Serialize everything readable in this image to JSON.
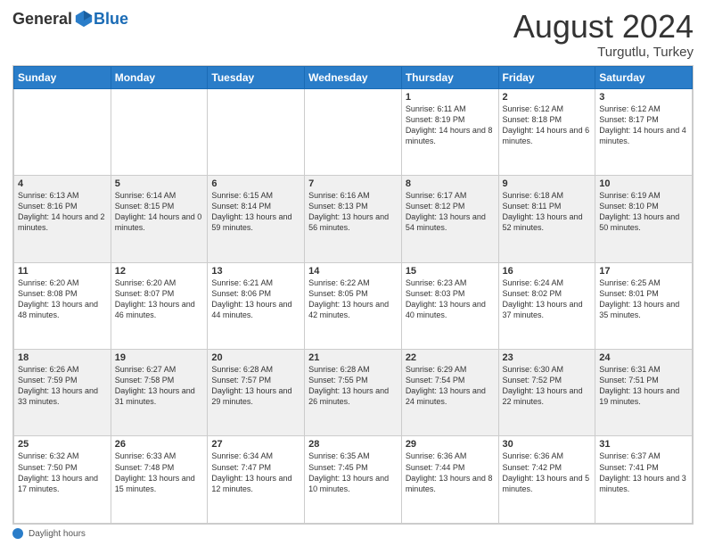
{
  "header": {
    "logo": {
      "general": "General",
      "blue": "Blue"
    },
    "title": "August 2024",
    "location": "Turgutlu, Turkey"
  },
  "calendar": {
    "days_of_week": [
      "Sunday",
      "Monday",
      "Tuesday",
      "Wednesday",
      "Thursday",
      "Friday",
      "Saturday"
    ],
    "weeks": [
      [
        {
          "day": "",
          "info": ""
        },
        {
          "day": "",
          "info": ""
        },
        {
          "day": "",
          "info": ""
        },
        {
          "day": "",
          "info": ""
        },
        {
          "day": "1",
          "info": "Sunrise: 6:11 AM\nSunset: 8:19 PM\nDaylight: 14 hours and 8 minutes."
        },
        {
          "day": "2",
          "info": "Sunrise: 6:12 AM\nSunset: 8:18 PM\nDaylight: 14 hours and 6 minutes."
        },
        {
          "day": "3",
          "info": "Sunrise: 6:12 AM\nSunset: 8:17 PM\nDaylight: 14 hours and 4 minutes."
        }
      ],
      [
        {
          "day": "4",
          "info": "Sunrise: 6:13 AM\nSunset: 8:16 PM\nDaylight: 14 hours and 2 minutes."
        },
        {
          "day": "5",
          "info": "Sunrise: 6:14 AM\nSunset: 8:15 PM\nDaylight: 14 hours and 0 minutes."
        },
        {
          "day": "6",
          "info": "Sunrise: 6:15 AM\nSunset: 8:14 PM\nDaylight: 13 hours and 59 minutes."
        },
        {
          "day": "7",
          "info": "Sunrise: 6:16 AM\nSunset: 8:13 PM\nDaylight: 13 hours and 56 minutes."
        },
        {
          "day": "8",
          "info": "Sunrise: 6:17 AM\nSunset: 8:12 PM\nDaylight: 13 hours and 54 minutes."
        },
        {
          "day": "9",
          "info": "Sunrise: 6:18 AM\nSunset: 8:11 PM\nDaylight: 13 hours and 52 minutes."
        },
        {
          "day": "10",
          "info": "Sunrise: 6:19 AM\nSunset: 8:10 PM\nDaylight: 13 hours and 50 minutes."
        }
      ],
      [
        {
          "day": "11",
          "info": "Sunrise: 6:20 AM\nSunset: 8:08 PM\nDaylight: 13 hours and 48 minutes."
        },
        {
          "day": "12",
          "info": "Sunrise: 6:20 AM\nSunset: 8:07 PM\nDaylight: 13 hours and 46 minutes."
        },
        {
          "day": "13",
          "info": "Sunrise: 6:21 AM\nSunset: 8:06 PM\nDaylight: 13 hours and 44 minutes."
        },
        {
          "day": "14",
          "info": "Sunrise: 6:22 AM\nSunset: 8:05 PM\nDaylight: 13 hours and 42 minutes."
        },
        {
          "day": "15",
          "info": "Sunrise: 6:23 AM\nSunset: 8:03 PM\nDaylight: 13 hours and 40 minutes."
        },
        {
          "day": "16",
          "info": "Sunrise: 6:24 AM\nSunset: 8:02 PM\nDaylight: 13 hours and 37 minutes."
        },
        {
          "day": "17",
          "info": "Sunrise: 6:25 AM\nSunset: 8:01 PM\nDaylight: 13 hours and 35 minutes."
        }
      ],
      [
        {
          "day": "18",
          "info": "Sunrise: 6:26 AM\nSunset: 7:59 PM\nDaylight: 13 hours and 33 minutes."
        },
        {
          "day": "19",
          "info": "Sunrise: 6:27 AM\nSunset: 7:58 PM\nDaylight: 13 hours and 31 minutes."
        },
        {
          "day": "20",
          "info": "Sunrise: 6:28 AM\nSunset: 7:57 PM\nDaylight: 13 hours and 29 minutes."
        },
        {
          "day": "21",
          "info": "Sunrise: 6:28 AM\nSunset: 7:55 PM\nDaylight: 13 hours and 26 minutes."
        },
        {
          "day": "22",
          "info": "Sunrise: 6:29 AM\nSunset: 7:54 PM\nDaylight: 13 hours and 24 minutes."
        },
        {
          "day": "23",
          "info": "Sunrise: 6:30 AM\nSunset: 7:52 PM\nDaylight: 13 hours and 22 minutes."
        },
        {
          "day": "24",
          "info": "Sunrise: 6:31 AM\nSunset: 7:51 PM\nDaylight: 13 hours and 19 minutes."
        }
      ],
      [
        {
          "day": "25",
          "info": "Sunrise: 6:32 AM\nSunset: 7:50 PM\nDaylight: 13 hours and 17 minutes."
        },
        {
          "day": "26",
          "info": "Sunrise: 6:33 AM\nSunset: 7:48 PM\nDaylight: 13 hours and 15 minutes."
        },
        {
          "day": "27",
          "info": "Sunrise: 6:34 AM\nSunset: 7:47 PM\nDaylight: 13 hours and 12 minutes."
        },
        {
          "day": "28",
          "info": "Sunrise: 6:35 AM\nSunset: 7:45 PM\nDaylight: 13 hours and 10 minutes."
        },
        {
          "day": "29",
          "info": "Sunrise: 6:36 AM\nSunset: 7:44 PM\nDaylight: 13 hours and 8 minutes."
        },
        {
          "day": "30",
          "info": "Sunrise: 6:36 AM\nSunset: 7:42 PM\nDaylight: 13 hours and 5 minutes."
        },
        {
          "day": "31",
          "info": "Sunrise: 6:37 AM\nSunset: 7:41 PM\nDaylight: 13 hours and 3 minutes."
        }
      ]
    ]
  },
  "footer": {
    "label": "Daylight hours"
  }
}
